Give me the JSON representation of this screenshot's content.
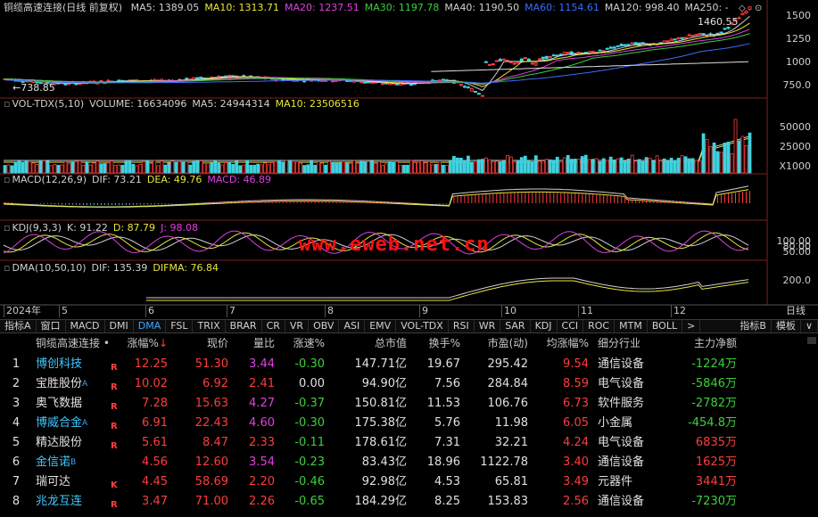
{
  "price_chart": {
    "title": "铜缆高速连接(日线 前复权)",
    "ma_items": [
      {
        "label": "MA5: 1389.05",
        "color": "#d0d0d0"
      },
      {
        "label": "MA10: 1313.71",
        "color": "#e6e63c"
      },
      {
        "label": "MA20: 1237.51",
        "color": "#e040e0"
      },
      {
        "label": "MA30: 1197.78",
        "color": "#3ccf3c"
      },
      {
        "label": "MA40: 1190.50",
        "color": "#d0d0d0"
      },
      {
        "label": "MA60: 1154.61",
        "color": "#3c6cff"
      },
      {
        "label": "MA120: 998.40",
        "color": "#d0d0d0"
      },
      {
        "label": "MA250: -",
        "color": "#d0d0d0"
      }
    ],
    "high_marker": "1460.55",
    "low_marker": "738.85",
    "y_ticks": [
      "1500",
      "1250",
      "1000",
      "750.0"
    ]
  },
  "volume_chart": {
    "items": [
      {
        "label": "VOL-TDX(5,10)",
        "color": "#d0d0d0"
      },
      {
        "label": "VOLUME: 16634096",
        "color": "#d0d0d0"
      },
      {
        "label": "MA5: 24944314",
        "color": "#d0d0d0"
      },
      {
        "label": "MA10: 23506516",
        "color": "#e6e63c"
      }
    ],
    "y_ticks": [
      "50000",
      "25000",
      "X1000"
    ]
  },
  "macd_chart": {
    "items": [
      {
        "label": "MACD(12,26,9)",
        "color": "#d0d0d0"
      },
      {
        "label": "DIF: 73.21",
        "color": "#d0d0d0"
      },
      {
        "label": "DEA: 49.76",
        "color": "#e6e63c"
      },
      {
        "label": "MACD: 46.89",
        "color": "#e040e0"
      }
    ]
  },
  "kdj_chart": {
    "items": [
      {
        "label": "KDJ(9,3,3)",
        "color": "#d0d0d0"
      },
      {
        "label": "K: 91.22",
        "color": "#d0d0d0"
      },
      {
        "label": "D: 87.79",
        "color": "#e6e63c"
      },
      {
        "label": "J: 98.08",
        "color": "#e040e0"
      }
    ],
    "y_ticks": [
      "100.00",
      "80.00",
      "50.00"
    ]
  },
  "dma_chart": {
    "items": [
      {
        "label": "DMA(10,50,10)",
        "color": "#d0d0d0"
      },
      {
        "label": "DIF: 135.39",
        "color": "#d0d0d0"
      },
      {
        "label": "DIFMA: 76.84",
        "color": "#e6e63c"
      }
    ],
    "y_ticks": [
      "200.0"
    ]
  },
  "time_axis": {
    "labels": [
      "2024年",
      "5",
      "6",
      "7",
      "8",
      "9",
      "10",
      "11",
      "12"
    ],
    "period": "日线"
  },
  "tabs": {
    "left": [
      "指标A",
      "窗口",
      "MACD",
      "DMI",
      "DMA",
      "FSL",
      "TRIX",
      "BRAR",
      "CR",
      "VR",
      "OBV",
      "ASI",
      "EMV",
      "VOL-TDX",
      "RSI",
      "WR",
      "SAR",
      "KDJ",
      "CCI",
      "ROC",
      "MTM",
      "BOLL",
      ">"
    ],
    "active": "DMA",
    "right": [
      "指标B",
      "模板",
      "∨"
    ]
  },
  "watermark": "www.eweb.net.cn",
  "table": {
    "headers": {
      "name": "铜缆高速连接 •",
      "chg": "涨幅%",
      "sort_icon": "↓",
      "price": "现价",
      "vr": "量比",
      "spd": "涨速%",
      "mcap": "总市值",
      "turn": "换手%",
      "pe": "市盈(动)",
      "avg": "均涨幅%",
      "ind": "细分行业",
      "flow": "主力净额"
    },
    "rows": [
      {
        "idx": "1",
        "name": "博创科技",
        "name_color": "cyan",
        "sup": "",
        "tag": "R",
        "chg": "12.25",
        "price": "51.30",
        "vr": "3.44",
        "vr_color": "mag",
        "spd": "-0.30",
        "spd_color": "grn",
        "mcap": "147.71亿",
        "turn": "19.67",
        "pe": "295.42",
        "avg": "9.54",
        "ind": "通信设备",
        "flow": "-1224万",
        "flow_color": "grn"
      },
      {
        "idx": "2",
        "name": "宝胜股份",
        "name_color": "wht",
        "sup": "A",
        "tag": "R",
        "chg": "10.02",
        "price": "6.92",
        "vr": "2.41",
        "vr_color": "red",
        "spd": "0.00",
        "spd_color": "wht",
        "mcap": "94.90亿",
        "turn": "7.56",
        "pe": "284.84",
        "avg": "8.59",
        "ind": "电气设备",
        "flow": "-5846万",
        "flow_color": "grn"
      },
      {
        "idx": "3",
        "name": "奥飞数据",
        "name_color": "wht",
        "sup": "",
        "tag": "R",
        "chg": "7.28",
        "price": "15.63",
        "vr": "4.27",
        "vr_color": "mag",
        "spd": "-0.37",
        "spd_color": "grn",
        "mcap": "150.81亿",
        "turn": "11.53",
        "pe": "106.76",
        "avg": "6.73",
        "ind": "软件服务",
        "flow": "-2782万",
        "flow_color": "grn"
      },
      {
        "idx": "4",
        "name": "博威合金",
        "name_color": "cyan",
        "sup": "A",
        "tag": "R",
        "chg": "6.91",
        "price": "22.43",
        "vr": "4.60",
        "vr_color": "mag",
        "spd": "-0.30",
        "spd_color": "grn",
        "mcap": "175.38亿",
        "turn": "5.76",
        "pe": "11.98",
        "avg": "6.05",
        "ind": "小金属",
        "flow": "-454.8万",
        "flow_color": "grn"
      },
      {
        "idx": "5",
        "name": "精达股份",
        "name_color": "wht",
        "sup": "",
        "tag": "R",
        "chg": "5.61",
        "price": "8.47",
        "vr": "2.33",
        "vr_color": "red",
        "spd": "-0.11",
        "spd_color": "grn",
        "mcap": "178.61亿",
        "turn": "7.31",
        "pe": "32.21",
        "avg": "4.24",
        "ind": "电气设备",
        "flow": "6835万",
        "flow_color": "red"
      },
      {
        "idx": "6",
        "name": "金信诺",
        "name_color": "cyan",
        "sup": "B",
        "tag": "",
        "chg": "4.56",
        "price": "12.60",
        "vr": "3.54",
        "vr_color": "mag",
        "spd": "-0.23",
        "spd_color": "grn",
        "mcap": "83.43亿",
        "turn": "18.96",
        "pe": "1122.78",
        "avg": "3.40",
        "ind": "通信设备",
        "flow": "1625万",
        "flow_color": "red"
      },
      {
        "idx": "7",
        "name": "瑞可达",
        "name_color": "wht",
        "sup": "",
        "tag": "K",
        "chg": "4.45",
        "price": "58.69",
        "vr": "2.20",
        "vr_color": "red",
        "spd": "-0.46",
        "spd_color": "grn",
        "mcap": "92.98亿",
        "turn": "4.53",
        "pe": "65.81",
        "avg": "3.49",
        "ind": "元器件",
        "flow": "3441万",
        "flow_color": "red"
      },
      {
        "idx": "8",
        "name": "兆龙互连",
        "name_color": "cyan",
        "sup": "",
        "tag": "R",
        "chg": "3.47",
        "price": "71.00",
        "vr": "2.26",
        "vr_color": "red",
        "spd": "-0.65",
        "spd_color": "grn",
        "mcap": "184.29亿",
        "turn": "8.25",
        "pe": "153.83",
        "avg": "2.56",
        "ind": "通信设备",
        "flow": "-7230万",
        "flow_color": "grn"
      }
    ]
  }
}
